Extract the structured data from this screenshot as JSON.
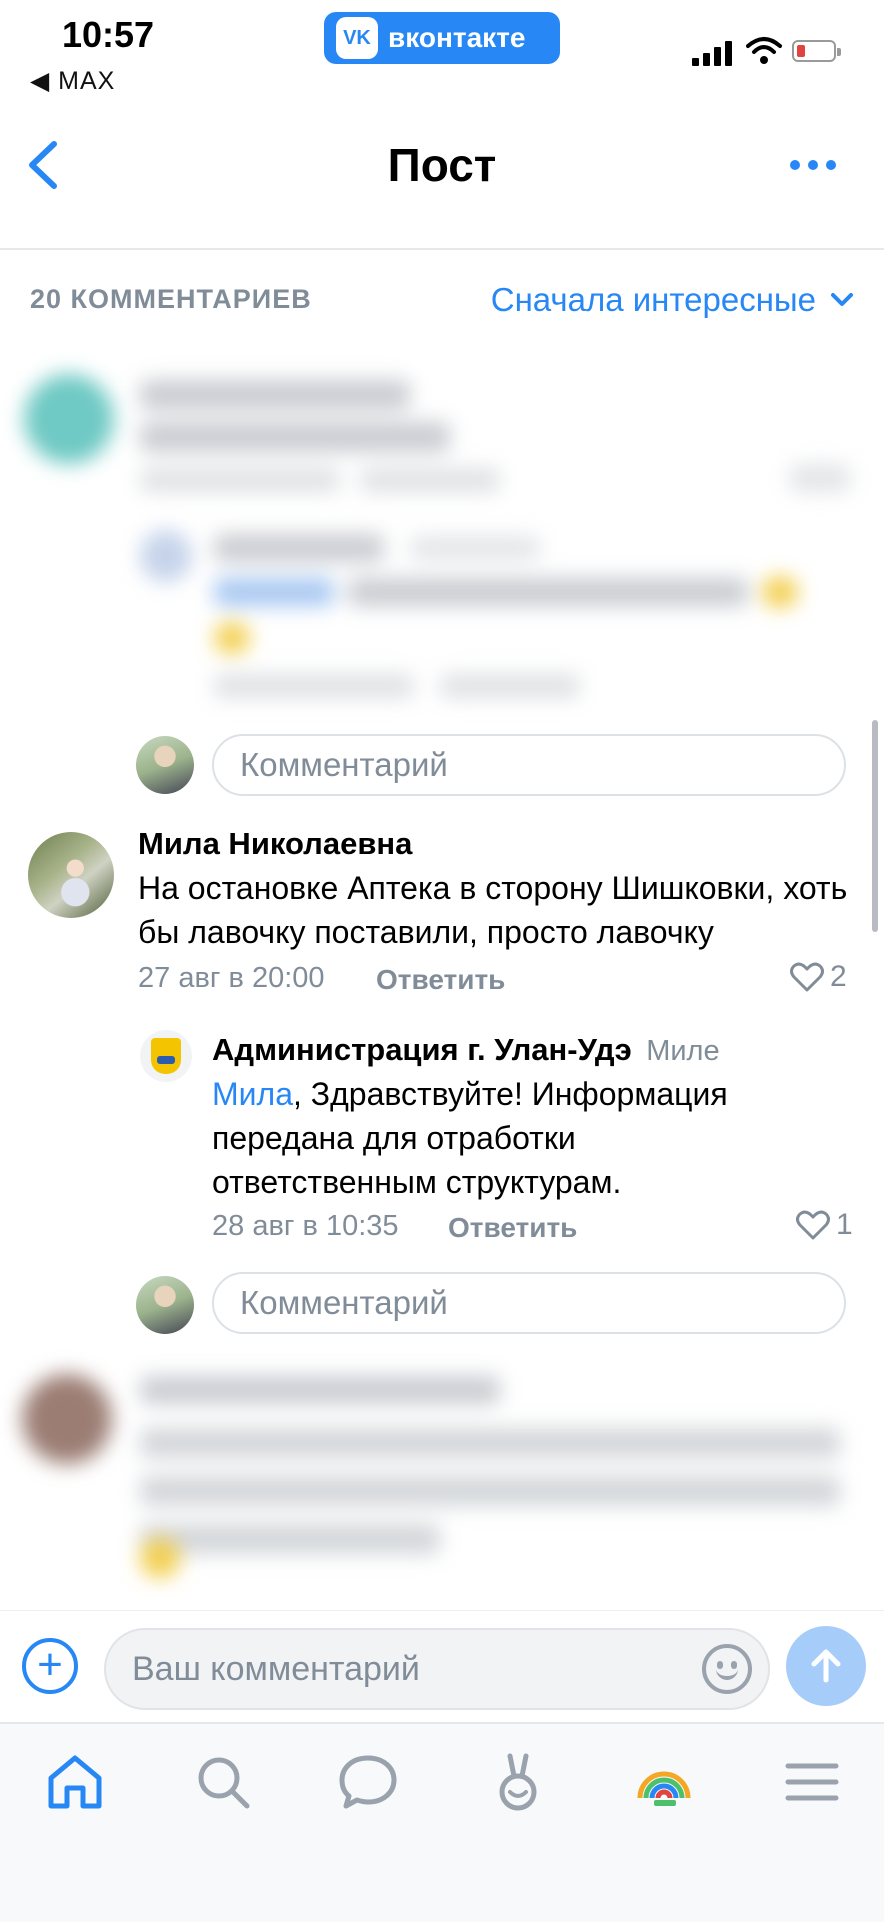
{
  "status_bar": {
    "time": "10:57",
    "back_app": "◀ MAX",
    "app_badge": "вконтакте",
    "battery_color": "#e0443e"
  },
  "nav": {
    "title": "Пост",
    "back_icon": "chevron-left-icon",
    "more_icon": "more-horizontal-icon"
  },
  "comments_header": {
    "count": "20 КОММЕНТАРИЕВ",
    "sort": "Сначала интересные"
  },
  "reply_placeholder": "Комментарий",
  "comments": [
    {
      "author": "Мила Николаевна",
      "text": "На остановке Аптека в сторону Шишковки, хоть бы лавочку поставили, просто лавочку",
      "date": "27 авг в 20:00",
      "reply_label": "Ответить",
      "likes": "2",
      "replies": [
        {
          "author": "Администрация г. Улан-Удэ",
          "to": "Миле",
          "mention": "Мила",
          "text": ", Здравствуйте! Информация передана для отработки ответственным структурам.",
          "date": "28 авг в 10:35",
          "reply_label": "Ответить",
          "likes": "1"
        }
      ]
    }
  ],
  "composer": {
    "placeholder": "Ваш комментарий",
    "add_icon": "plus-circle-icon",
    "emoji_icon": "smile-icon",
    "send_icon": "arrow-up-icon"
  },
  "tabbar": {
    "items": [
      "home-icon",
      "search-icon",
      "messages-icon",
      "clips-icon",
      "services-icon",
      "menu-icon"
    ]
  },
  "colors": {
    "accent": "#2787f5",
    "secondary_text": "#818c99"
  }
}
